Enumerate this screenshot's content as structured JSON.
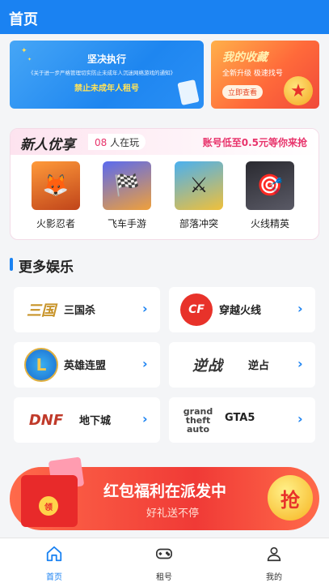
{
  "header": {
    "title": "首页"
  },
  "banners": {
    "notice": {
      "title": "坚决执行",
      "subtitle": "《关于进一步严格管理切实防止未成年人沉迷网络游戏的通知》",
      "warning": "禁止未成年人租号"
    },
    "favorites": {
      "title": "我的收藏",
      "subtitle": "全新升级 极速找号",
      "button": "立即查看"
    }
  },
  "new_user": {
    "title": "新人优享",
    "playing_count": "08",
    "playing_suffix": "人在玩",
    "promo": "账号低至0.5元等你来抢",
    "games": [
      {
        "name": "火影忍者",
        "icon": "naruto-icon"
      },
      {
        "name": "飞车手游",
        "icon": "racer-icon"
      },
      {
        "name": "部落冲突",
        "icon": "clash-icon"
      },
      {
        "name": "火线精英",
        "icon": "soldier-icon"
      }
    ]
  },
  "more": {
    "title": "更多娱乐",
    "items": [
      {
        "name": "三国杀",
        "icon": "sanguosha-logo"
      },
      {
        "name": "穿越火线",
        "icon": "crossfire-logo"
      },
      {
        "name": "英雄连盟",
        "icon": "lol-logo"
      },
      {
        "name": "逆占",
        "icon": "nizhan-logo"
      },
      {
        "name": "地下城",
        "icon": "dnf-logo"
      },
      {
        "name": "GTA5",
        "icon": "gta-logo"
      }
    ]
  },
  "red_banner": {
    "title": "红包福利在派发中",
    "subtitle": "好礼送不停",
    "button": "抢",
    "coin": "领"
  },
  "tabbar": {
    "items": [
      {
        "label": "首页",
        "icon": "home-icon",
        "active": true
      },
      {
        "label": "租号",
        "icon": "gamepad-icon",
        "active": false
      },
      {
        "label": "我的",
        "icon": "user-icon",
        "active": false
      }
    ]
  },
  "colors": {
    "primary": "#1a82f2",
    "accent": "#e8336b",
    "red": "#f03a36"
  }
}
